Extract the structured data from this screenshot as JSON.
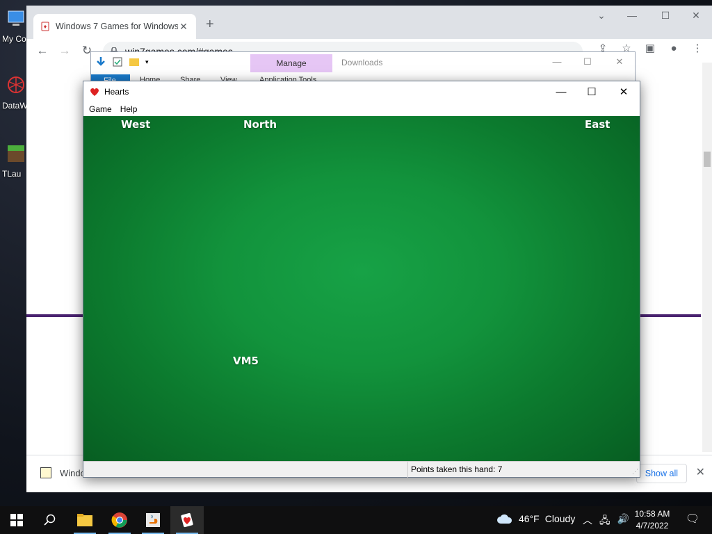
{
  "desktop": {
    "icons": [
      {
        "label": "My Co"
      },
      {
        "label": "DataW"
      },
      {
        "label": "TLau"
      }
    ]
  },
  "chrome": {
    "tab_title": "Windows 7 Games for Windows",
    "url": "win7games.com/#games",
    "download_item": "Windo",
    "show_all": "Show all"
  },
  "explorer": {
    "manage_label": "Manage",
    "title": "Downloads",
    "file_tab": "File",
    "ribbon_tabs": [
      "Home",
      "Share",
      "View",
      "Application Tools"
    ]
  },
  "hearts": {
    "title": "Hearts",
    "menu": [
      "Game",
      "Help"
    ],
    "players": {
      "west": "West",
      "north": "North",
      "east": "East",
      "south": "VM5"
    },
    "status": "Points taken this hand: 7",
    "colors": {
      "felt": "#12933c"
    }
  },
  "taskbar": {
    "apps": [
      "start",
      "search",
      "file-explorer",
      "chrome",
      "java",
      "hearts"
    ],
    "weather": {
      "temp": "46°F",
      "condition": "Cloudy"
    },
    "time": "10:58 AM",
    "date": "4/7/2022"
  }
}
